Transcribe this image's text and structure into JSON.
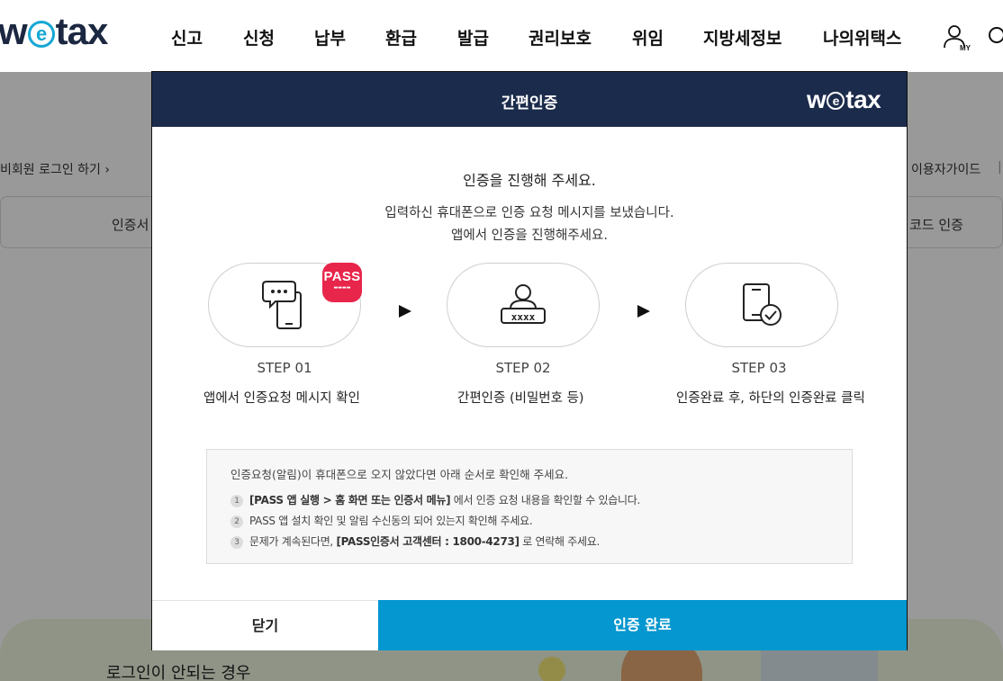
{
  "header": {
    "logo": {
      "pre": "w",
      "e": "e",
      "post": "tax"
    },
    "nav": [
      "신고",
      "신청",
      "납부",
      "환급",
      "발급",
      "권리보호",
      "위임",
      "지방세정보",
      "나의위택스"
    ]
  },
  "page": {
    "nonmember_login": "비회원 로그인 하기",
    "user_guide": "이용자가이드",
    "guide_separator": "|",
    "tab_left": "인증서",
    "tab_right": "코드 인증",
    "banner_text": "로그인이 안되는 경우"
  },
  "modal": {
    "title": "간편인증",
    "logo": {
      "pre": "w",
      "e": "e",
      "post": "tax"
    },
    "headline": "인증을 진행해 주세요.",
    "subline1": "입력하신 휴대폰으로 인증 요청 메시지를 보냈습니다.",
    "subline2": "앱에서 인증을 진행해주세요.",
    "pass_badge": "PASS",
    "steps": [
      {
        "label": "STEP 01",
        "desc": "앱에서 인증요청 메시지 확인",
        "icon": "phone-chat-icon"
      },
      {
        "label": "STEP 02",
        "desc": "간편인증 (비밀번호 등)",
        "icon": "user-password-icon"
      },
      {
        "label": "STEP 03",
        "desc": "인증완료 후, 하단의 인증완료 클릭",
        "icon": "phone-check-icon"
      }
    ],
    "notice": {
      "title": "인증요청(알림)이 휴대폰으로 오지 않았다면 아래 순서로 확인해 주세요.",
      "items": [
        {
          "num": "1",
          "bold": "[PASS 앱 실행 > 홈 화면 또는 인증서 메뉴]",
          "text": " 에서 인증 요청 내용을 확인할 수 있습니다."
        },
        {
          "num": "2",
          "bold": "",
          "text": "PASS 앱 설치 확인 및 알림 수신동의 되어 있는지 확인해 주세요."
        },
        {
          "num": "3",
          "pre": "문제가 계속된다면, ",
          "bold": "[PASS인증서 고객센터 : 1800-4273]",
          "text": " 로 연락해 주세요."
        }
      ]
    },
    "close_label": "닫기",
    "done_label": "인증 완료"
  },
  "colors": {
    "header_navy": "#1b2b4b",
    "accent_blue": "#0597cf",
    "logo_e": "#15a7d4",
    "pass_red": "#e8254b"
  }
}
